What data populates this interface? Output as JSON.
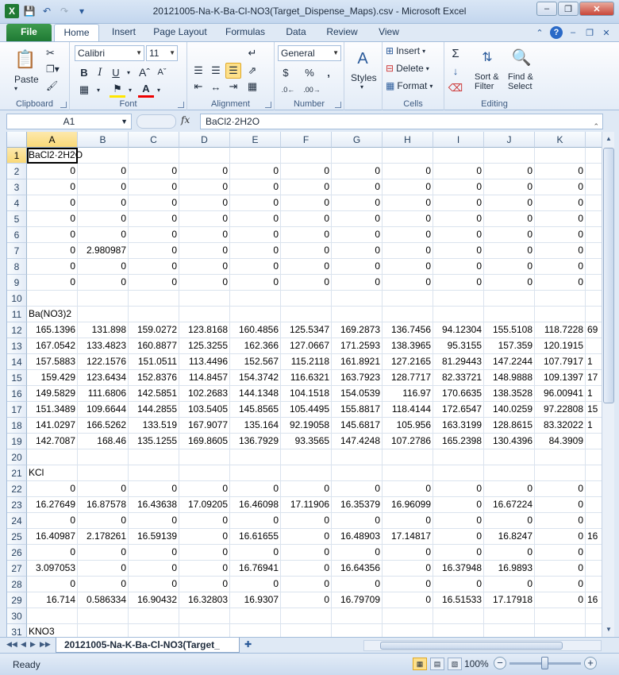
{
  "window": {
    "title": "20121005-Na-K-Ba-Cl-NO3(Target_Dispense_Maps).csv  -  Microsoft Excel"
  },
  "ribbon_tabs": [
    "File",
    "Home",
    "Insert",
    "Page Layout",
    "Formulas",
    "Data",
    "Review",
    "View"
  ],
  "ribbon": {
    "paste_label": "Paste",
    "clipboard_label": "Clipboard",
    "font_name": "Calibri",
    "font_size": "11",
    "font_label": "Font",
    "alignment_label": "Alignment",
    "number_format": "General",
    "number_label": "Number",
    "styles_label": "Styles",
    "insert_label": "Insert",
    "delete_label": "Delete",
    "format_label": "Format",
    "cells_label": "Cells",
    "sort_filter_label": "Sort &\nFilter",
    "find_select_label": "Find &\nSelect",
    "editing_label": "Editing"
  },
  "formula_bar": {
    "name_box": "A1",
    "fx": "fx",
    "content": "BaCl2·2H2O"
  },
  "columns": [
    "A",
    "B",
    "C",
    "D",
    "E",
    "F",
    "G",
    "H",
    "I",
    "J",
    "K"
  ],
  "rows": [
    {
      "n": "1",
      "cells": [
        "BaCl2·2H2O",
        "",
        "",
        "",
        "",
        "",
        "",
        "",
        "",
        "",
        ""
      ]
    },
    {
      "n": "2",
      "cells": [
        "0",
        "0",
        "0",
        "0",
        "0",
        "0",
        "0",
        "0",
        "0",
        "0",
        "0"
      ]
    },
    {
      "n": "3",
      "cells": [
        "0",
        "0",
        "0",
        "0",
        "0",
        "0",
        "0",
        "0",
        "0",
        "0",
        "0"
      ]
    },
    {
      "n": "4",
      "cells": [
        "0",
        "0",
        "0",
        "0",
        "0",
        "0",
        "0",
        "0",
        "0",
        "0",
        "0"
      ]
    },
    {
      "n": "5",
      "cells": [
        "0",
        "0",
        "0",
        "0",
        "0",
        "0",
        "0",
        "0",
        "0",
        "0",
        "0"
      ]
    },
    {
      "n": "6",
      "cells": [
        "0",
        "0",
        "0",
        "0",
        "0",
        "0",
        "0",
        "0",
        "0",
        "0",
        "0"
      ]
    },
    {
      "n": "7",
      "cells": [
        "0",
        "2.980987",
        "0",
        "0",
        "0",
        "0",
        "0",
        "0",
        "0",
        "0",
        "0"
      ]
    },
    {
      "n": "8",
      "cells": [
        "0",
        "0",
        "0",
        "0",
        "0",
        "0",
        "0",
        "0",
        "0",
        "0",
        "0"
      ]
    },
    {
      "n": "9",
      "cells": [
        "0",
        "0",
        "0",
        "0",
        "0",
        "0",
        "0",
        "0",
        "0",
        "0",
        "0"
      ]
    },
    {
      "n": "10",
      "cells": [
        "",
        "",
        "",
        "",
        "",
        "",
        "",
        "",
        "",
        "",
        ""
      ]
    },
    {
      "n": "11",
      "cells": [
        "Ba(NO3)2",
        "",
        "",
        "",
        "",
        "",
        "",
        "",
        "",
        "",
        ""
      ]
    },
    {
      "n": "12",
      "cells": [
        "165.1396",
        "131.898",
        "159.0272",
        "123.8168",
        "160.4856",
        "125.5347",
        "169.2873",
        "136.7456",
        "94.12304",
        "155.5108",
        "118.7228"
      ]
    },
    {
      "n": "13",
      "cells": [
        "167.0542",
        "133.4823",
        "160.8877",
        "125.3255",
        "162.366",
        "127.0667",
        "171.2593",
        "138.3965",
        "95.3155",
        "157.359",
        "120.1915"
      ]
    },
    {
      "n": "14",
      "cells": [
        "157.5883",
        "122.1576",
        "151.0511",
        "113.4496",
        "152.567",
        "115.2118",
        "161.8921",
        "127.2165",
        "81.29443",
        "147.2244",
        "107.7917"
      ]
    },
    {
      "n": "15",
      "cells": [
        "159.429",
        "123.6434",
        "152.8376",
        "114.8457",
        "154.3742",
        "116.6321",
        "163.7923",
        "128.7717",
        "82.33721",
        "148.9888",
        "109.1397"
      ]
    },
    {
      "n": "16",
      "cells": [
        "149.5829",
        "111.6806",
        "142.5851",
        "102.2683",
        "144.1348",
        "104.1518",
        "154.0539",
        "116.97",
        "170.6635",
        "138.3528",
        "96.00941"
      ]
    },
    {
      "n": "17",
      "cells": [
        "151.3489",
        "109.6644",
        "144.2855",
        "103.5405",
        "145.8565",
        "105.4495",
        "155.8817",
        "118.4144",
        "172.6547",
        "140.0259",
        "97.22808"
      ]
    },
    {
      "n": "18",
      "cells": [
        "141.0297",
        "166.5262",
        "133.519",
        "167.9077",
        "135.164",
        "92.19058",
        "145.6817",
        "105.956",
        "163.3199",
        "128.8615",
        "83.32022"
      ]
    },
    {
      "n": "19",
      "cells": [
        "142.7087",
        "168.46",
        "135.1255",
        "169.8605",
        "136.7929",
        "93.3565",
        "147.4248",
        "107.2786",
        "165.2398",
        "130.4396",
        "84.3909"
      ]
    },
    {
      "n": "20",
      "cells": [
        "",
        "",
        "",
        "",
        "",
        "",
        "",
        "",
        "",
        "",
        ""
      ]
    },
    {
      "n": "21",
      "cells": [
        "KCl",
        "",
        "",
        "",
        "",
        "",
        "",
        "",
        "",
        "",
        ""
      ]
    },
    {
      "n": "22",
      "cells": [
        "0",
        "0",
        "0",
        "0",
        "0",
        "0",
        "0",
        "0",
        "0",
        "0",
        "0"
      ]
    },
    {
      "n": "23",
      "cells": [
        "16.27649",
        "16.87578",
        "16.43638",
        "17.09205",
        "16.46098",
        "17.11906",
        "16.35379",
        "16.96099",
        "0",
        "16.67224",
        "0"
      ]
    },
    {
      "n": "24",
      "cells": [
        "0",
        "0",
        "0",
        "0",
        "0",
        "0",
        "0",
        "0",
        "0",
        "0",
        "0"
      ]
    },
    {
      "n": "25",
      "cells": [
        "16.40987",
        "2.178261",
        "16.59139",
        "0",
        "16.61655",
        "0",
        "16.48903",
        "17.14817",
        "0",
        "16.8247",
        "0"
      ]
    },
    {
      "n": "26",
      "cells": [
        "0",
        "0",
        "0",
        "0",
        "0",
        "0",
        "0",
        "0",
        "0",
        "0",
        "0"
      ]
    },
    {
      "n": "27",
      "cells": [
        "3.097053",
        "0",
        "0",
        "0",
        "16.76941",
        "0",
        "16.64356",
        "0",
        "16.37948",
        "16.9893",
        "0"
      ]
    },
    {
      "n": "28",
      "cells": [
        "0",
        "0",
        "0",
        "0",
        "0",
        "0",
        "0",
        "0",
        "0",
        "0",
        "0"
      ]
    },
    {
      "n": "29",
      "cells": [
        "16.714",
        "0.586334",
        "16.90432",
        "16.32803",
        "16.9307",
        "0",
        "16.79709",
        "0",
        "16.51533",
        "17.17918",
        "0"
      ]
    },
    {
      "n": "30",
      "cells": [
        "",
        "",
        "",
        "",
        "",
        "",
        "",
        "",
        "",
        "",
        ""
      ]
    },
    {
      "n": "31",
      "cells": [
        "KNO3",
        "",
        "",
        "",
        "",
        "",
        "",
        "",
        "",
        "",
        ""
      ]
    }
  ],
  "overflow_col_L": [
    "",
    "",
    "",
    "",
    "",
    "",
    "",
    "",
    "",
    "",
    "",
    "69",
    "",
    "1",
    "17",
    "1",
    "15",
    "1",
    "",
    "",
    "",
    "",
    "",
    "",
    "16",
    "",
    "",
    "",
    "16",
    "",
    ""
  ],
  "sheet_tab": "20121005-Na-K-Ba-Cl-NO3(Target_",
  "status": {
    "ready": "Ready",
    "zoom": "100%"
  }
}
